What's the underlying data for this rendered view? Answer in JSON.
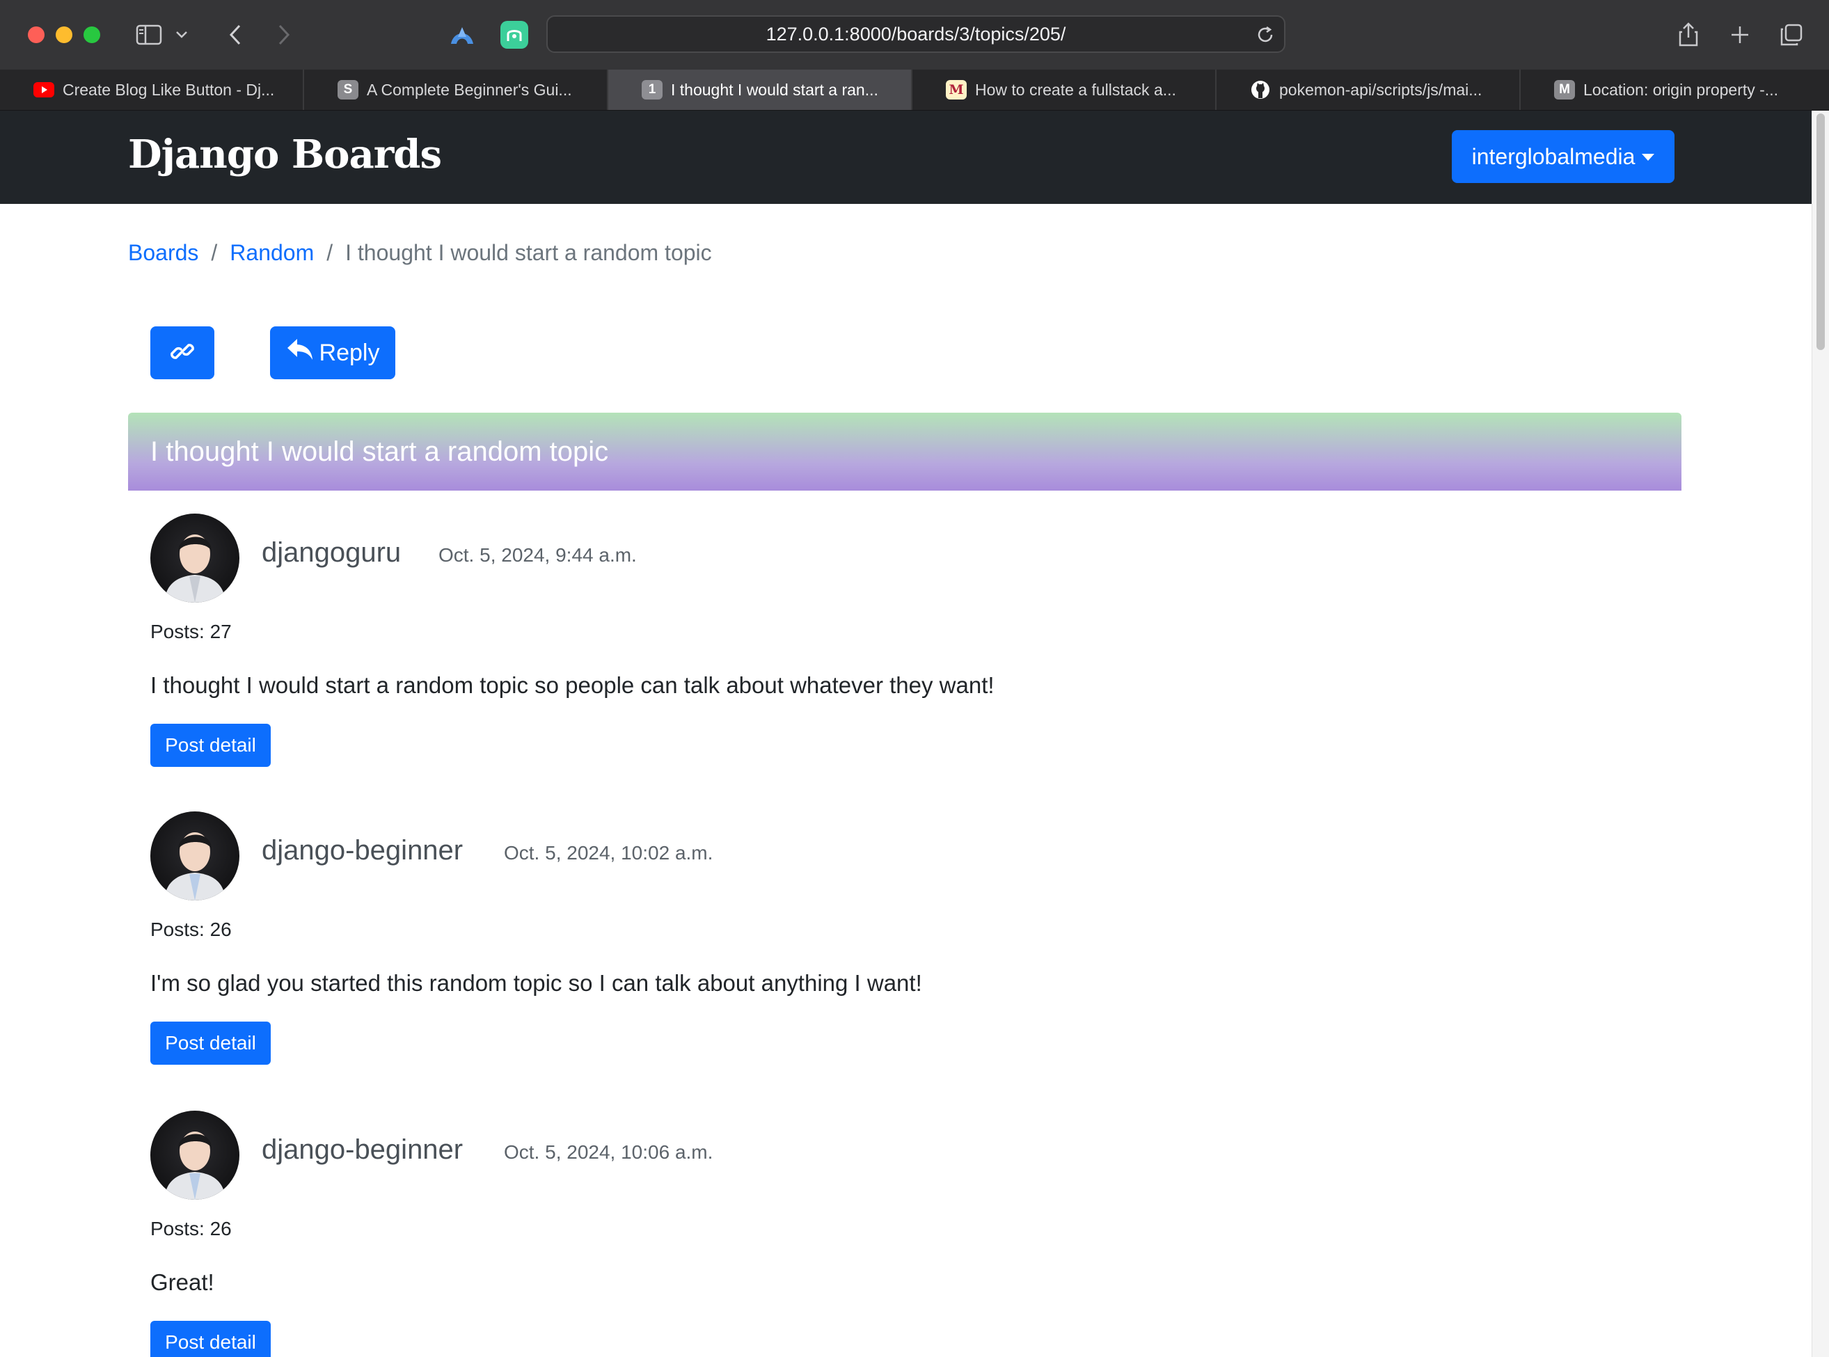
{
  "browser": {
    "url": "127.0.0.1:8000/boards/3/topics/205/",
    "tabs": [
      {
        "label": "Create Blog Like Button - Dj...",
        "favicon": "youtube-icon",
        "active": false
      },
      {
        "label": "A Complete Beginner's Gui...",
        "favicon": "s-letter-icon",
        "favicon_text": "S",
        "active": false
      },
      {
        "label": "I thought I would start a ran...",
        "favicon": "number-one-icon",
        "favicon_text": "1",
        "active": true
      },
      {
        "label": "How to create a fullstack a...",
        "favicon": "medium-m-icon",
        "favicon_text": "M",
        "active": false
      },
      {
        "label": "pokemon-api/scripts/js/mai...",
        "favicon": "github-icon",
        "active": false
      },
      {
        "label": "Location: origin property -...",
        "favicon": "m-letter-icon",
        "favicon_text": "M",
        "active": false
      }
    ]
  },
  "navbar": {
    "brand": "Django Boards",
    "user_menu": "interglobalmedia"
  },
  "breadcrumb": {
    "boards": "Boards",
    "board": "Random",
    "topic": "I thought I would start a random topic",
    "separator": "/"
  },
  "actions": {
    "reply_label": "Reply"
  },
  "topic": {
    "title": "I thought I would start a random topic"
  },
  "posts": [
    {
      "username": "djangoguru",
      "date": "Oct. 5, 2024, 9:44 a.m.",
      "posts_count": "Posts: 27",
      "message": "I thought I would start a random topic so people can talk about whatever they want!",
      "detail_label": "Post detail"
    },
    {
      "username": "django-beginner",
      "date": "Oct. 5, 2024, 10:02 a.m.",
      "posts_count": "Posts: 26",
      "message": "I'm so glad you started this random topic so I can talk about anything I want!",
      "detail_label": "Post detail"
    },
    {
      "username": "django-beginner",
      "date": "Oct. 5, 2024, 10:06 a.m.",
      "posts_count": "Posts: 26",
      "message": "Great!",
      "detail_label": "Post detail"
    }
  ],
  "colors": {
    "primary": "#0d6efd",
    "navbar_bg": "#212529",
    "header_gradient_top": "#b4e3b8",
    "header_gradient_bottom": "#a88cdb"
  }
}
